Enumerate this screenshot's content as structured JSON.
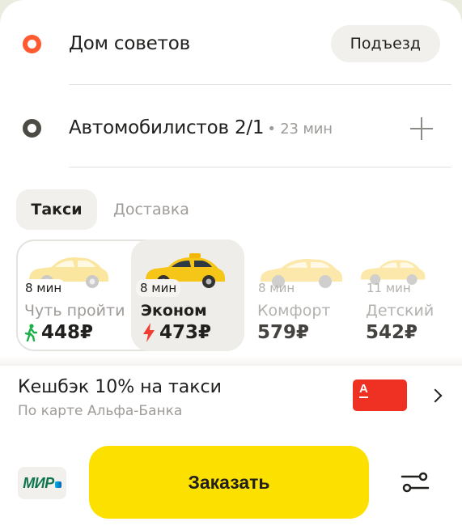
{
  "route": {
    "from": {
      "address": "Дом советов",
      "entrance_label": "Подъезд"
    },
    "to": {
      "address": "Автомобилистов 2/1",
      "eta": "• 23 мин"
    }
  },
  "tabs": [
    {
      "label": "Такси",
      "active": true
    },
    {
      "label": "Доставка",
      "active": false
    }
  ],
  "tariffs": [
    {
      "name": "Чуть пройти",
      "eta": "8 мин",
      "price": "448₽",
      "icon": "walk-icon"
    },
    {
      "name": "Эконом",
      "eta": "8 мин",
      "price": "473₽",
      "icon": "lightning-icon",
      "selected": true
    },
    {
      "name": "Комфорт",
      "eta": "8 мин",
      "price": "579₽"
    },
    {
      "name": "Детский",
      "eta": "11 мин",
      "price": "542₽"
    }
  ],
  "cashback": {
    "title": "Кешбэк 10% на такси",
    "subtitle": "По карте Альфа-Банка",
    "bank_letter": "А"
  },
  "payment": {
    "label": "МИР"
  },
  "order_button": {
    "label": "Заказать"
  },
  "colors": {
    "accent": "#fce000",
    "origin_marker": "#ff5a30",
    "dest_marker": "#4b4a45",
    "walk_icon": "#1bb04a",
    "lightning_icon": "#f23b32",
    "bank_card": "#ef3124",
    "mir_green": "#0f754e"
  }
}
